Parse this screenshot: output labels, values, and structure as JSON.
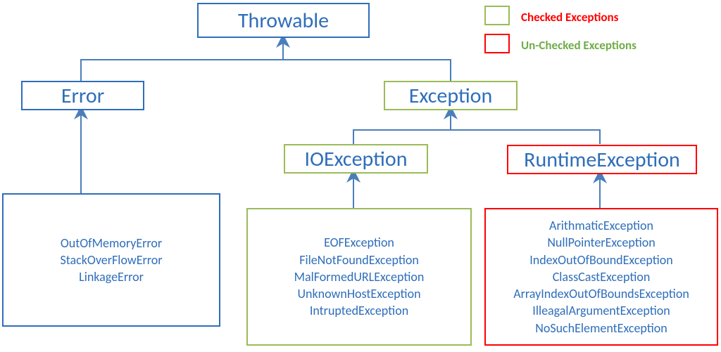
{
  "legend": {
    "checked": "Checked Exceptions",
    "unchecked": "Un-Checked Exceptions"
  },
  "nodes": {
    "throwable": "Throwable",
    "error": "Error",
    "exception": "Exception",
    "ioexception": "IOException",
    "runtimeexception": "RuntimeException"
  },
  "lists": {
    "errors": [
      "OutOfMemoryError",
      "StackOverFlowError",
      "LinkageError"
    ],
    "io": [
      "EOFException",
      "FileNotFoundException",
      "MalFormedURLException",
      "UnknownHostException",
      "IntruptedException"
    ],
    "runtime": [
      "ArithmaticException",
      "NullPointerException",
      "IndexOutOfBoundException",
      "ClassCastException",
      "ArrayIndexOutOfBoundsException",
      "IlleagalArgumentException",
      "NoSuchElementException"
    ]
  },
  "colors": {
    "blue": "#2F6EBA",
    "green": "#9BBB59",
    "red": "#FF0000"
  },
  "chart_data": {
    "type": "diagram",
    "title": "Java Exception Hierarchy",
    "legend": [
      {
        "swatch_color": "#9BBB59",
        "label": "Checked Exceptions",
        "label_color": "#FF0000"
      },
      {
        "swatch_color": "#FF0000",
        "label": "Un-Checked Exceptions",
        "label_color": "#9BBB59"
      }
    ],
    "nodes": [
      {
        "id": "throwable",
        "label": "Throwable",
        "border": "#2F6EBA",
        "category": null
      },
      {
        "id": "error",
        "label": "Error",
        "border": "#2F6EBA",
        "category": null
      },
      {
        "id": "exception",
        "label": "Exception",
        "border": "#9BBB59",
        "category": "checked"
      },
      {
        "id": "ioexception",
        "label": "IOException",
        "border": "#9BBB59",
        "category": "checked"
      },
      {
        "id": "runtimeexception",
        "label": "RuntimeException",
        "border": "#FF0000",
        "category": "unchecked"
      },
      {
        "id": "error_list",
        "border": "#2F6EBA",
        "items": [
          "OutOfMemoryError",
          "StackOverFlowError",
          "LinkageError"
        ],
        "category": null
      },
      {
        "id": "io_list",
        "border": "#9BBB59",
        "items": [
          "EOFException",
          "FileNotFoundException",
          "MalFormedURLException",
          "UnknownHostException",
          "IntruptedException"
        ],
        "category": "checked"
      },
      {
        "id": "runtime_list",
        "border": "#FF0000",
        "items": [
          "ArithmaticException",
          "NullPointerException",
          "IndexOutOfBoundException",
          "ClassCastException",
          "ArrayIndexOutOfBoundsException",
          "IlleagalArgumentException",
          "NoSuchElementException"
        ],
        "category": "unchecked"
      }
    ],
    "edges": [
      {
        "from": "error",
        "to": "throwable"
      },
      {
        "from": "exception",
        "to": "throwable"
      },
      {
        "from": "ioexception",
        "to": "exception"
      },
      {
        "from": "runtimeexception",
        "to": "exception"
      },
      {
        "from": "error_list",
        "to": "error"
      },
      {
        "from": "io_list",
        "to": "ioexception"
      },
      {
        "from": "runtime_list",
        "to": "runtimeexception"
      }
    ]
  }
}
